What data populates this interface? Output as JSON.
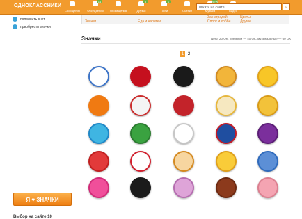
{
  "header": {
    "brand": "ОДНОКЛАССНИКИ",
    "nav": [
      {
        "label": "Сообщения",
        "badge": ""
      },
      {
        "label": "Обсуждения",
        "badge": "14"
      },
      {
        "label": "Оповещения",
        "badge": ""
      },
      {
        "label": "Друзья",
        "badge": "5"
      },
      {
        "label": "Гости",
        "badge": "1"
      },
      {
        "label": "Оценки",
        "badge": ""
      },
      {
        "label": "Музыка",
        "badge": "NEW"
      },
      {
        "label": "Видео",
        "badge": ""
      }
    ],
    "search_placeholder": "искать на сайте"
  },
  "sidebar": {
    "items": [
      {
        "label": "пополнить счет"
      },
      {
        "label": "приобрести значки"
      }
    ],
    "znachki_button": "Я ♥ ЗНАЧКИ",
    "bottom": "Выбор на сайте 10"
  },
  "categories": {
    "row1": [
      "Значки",
      "Еда и напитки",
      "Спорт и хобби",
      "Другое"
    ],
    "row0": [
      "",
      "",
      "За наградой",
      "Цветы"
    ]
  },
  "section": {
    "title": "Значки",
    "price_note": "Цена 20 ОК, премиум — 40 ОК, музыкальные — 60 ОК"
  },
  "pager": [
    "1",
    "2"
  ],
  "badges": [
    {
      "name": "dynamo",
      "color": "#ffffff",
      "ring": "#3c74c8"
    },
    {
      "name": "crown",
      "color": "#c5101e",
      "ring": "#c5101e"
    },
    {
      "name": "champion",
      "color": "#1a1a1a",
      "ring": "#1a1a1a"
    },
    {
      "name": "angry-smiley",
      "color": "#f2b53a",
      "ring": "#d08a22"
    },
    {
      "name": "smiley",
      "color": "#f8c627",
      "ring": "#e2a317"
    },
    {
      "name": "love-znachki",
      "color": "#f07a12",
      "ring": "#f07a12"
    },
    {
      "name": "rings",
      "color": "#f4f4f4",
      "ring": "#cc2d2d"
    },
    {
      "name": "vip",
      "color": "#c3232a",
      "ring": "#c3232a"
    },
    {
      "name": "star-ya",
      "color": "#f6e8c0",
      "ring": "#e7b73c"
    },
    {
      "name": "cup",
      "color": "#f2c23a",
      "ring": "#d99b16"
    },
    {
      "name": "world",
      "color": "#3fb5e2",
      "ring": "#1f88c7"
    },
    {
      "name": "football",
      "color": "#3aa240",
      "ring": "#2a7c2f"
    },
    {
      "name": "five",
      "color": "#ffffff",
      "ring": "#c7c7c7"
    },
    {
      "name": "russia",
      "color": "#1f4ea0",
      "ring": "#c61b27"
    },
    {
      "name": "purple",
      "color": "#7b2f9c",
      "ring": "#5c1e77"
    },
    {
      "name": "hand",
      "color": "#e23a3a",
      "ring": "#c11f1f"
    },
    {
      "name": "love-heart",
      "color": "#ffffff",
      "ring": "#d2202e"
    },
    {
      "name": "red-star",
      "color": "#f7d6a0",
      "ring": "#d68a1f"
    },
    {
      "name": "teeth-smile",
      "color": "#f9cc39",
      "ring": "#e0a11a"
    },
    {
      "name": "hochu",
      "color": "#5c8fd6",
      "ring": "#2f6bbd"
    },
    {
      "name": "pink",
      "color": "#f04f9a",
      "ring": "#d12b78"
    },
    {
      "name": "boss",
      "color": "#1b1b1b",
      "ring": "#1b1b1b"
    },
    {
      "name": "super-blond",
      "color": "#dea4d8",
      "ring": "#b56cb0"
    },
    {
      "name": "bear",
      "color": "#8c3a1c",
      "ring": "#6d2a12"
    },
    {
      "name": "teddy",
      "color": "#f4a4b2",
      "ring": "#dc7f90"
    }
  ]
}
